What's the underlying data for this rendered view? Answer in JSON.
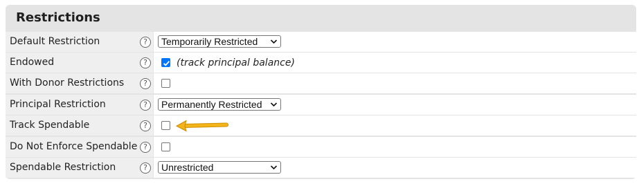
{
  "section": {
    "title": "Restrictions"
  },
  "help_glyph": "?",
  "rows": [
    {
      "label": "Default Restriction",
      "control": "select",
      "value": "Temporarily Restricted"
    },
    {
      "label": "Endowed",
      "control": "checkbox",
      "checked": true,
      "note": "(track principal balance)"
    },
    {
      "label": "With Donor Restrictions",
      "control": "checkbox",
      "checked": false
    },
    {
      "label": "Principal Restriction",
      "control": "select",
      "value": "Permanently Restricted"
    },
    {
      "label": "Track Spendable",
      "control": "checkbox",
      "checked": false,
      "highlight_arrow": true
    },
    {
      "label": "Do Not Enforce Spendable",
      "control": "checkbox",
      "checked": false
    },
    {
      "label": "Spendable Restriction",
      "control": "select",
      "value": "Unrestricted"
    }
  ],
  "colors": {
    "panel_bg": "#e4e4e4",
    "label_cell_bg": "#efefef",
    "value_cell_bg": "#ffffff",
    "checkbox_checked": "#0075ff",
    "arrow": "#f2b418"
  },
  "icons": {
    "help": "question-circle-icon",
    "select": "chevron-down-icon",
    "checked": "checkmark-icon",
    "callout": "arrow-left-icon"
  }
}
